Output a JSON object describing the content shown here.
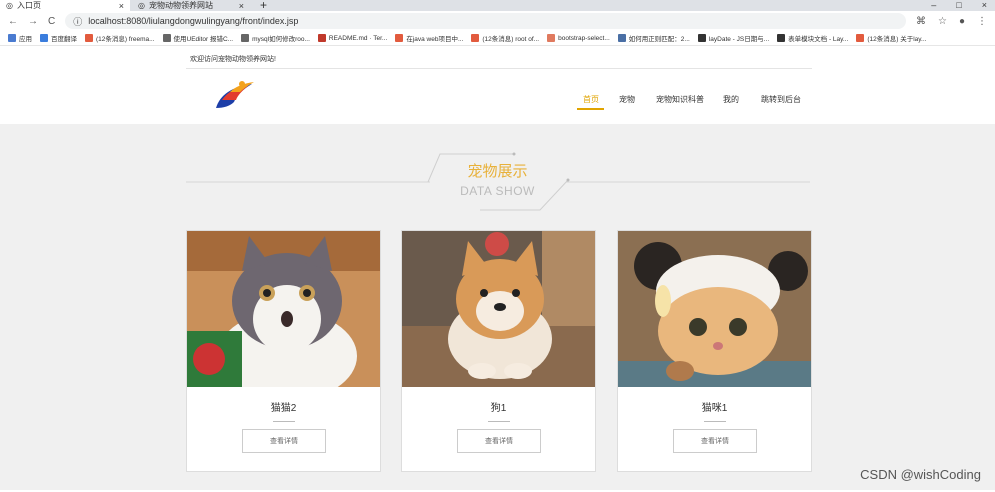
{
  "browser": {
    "tabs": [
      {
        "title": "入口页",
        "close": "×"
      },
      {
        "title": "宠物动物领养网站",
        "close": "×"
      }
    ],
    "new_tab": "+",
    "window_controls": [
      "–",
      "□",
      "×"
    ],
    "url": "localhost:8080/liulangdongwulingyang/front/index.jsp",
    "bookmarks": [
      {
        "label": "应用",
        "color": "#4a7bd0"
      },
      {
        "label": "百度翻译",
        "color": "#3b7ddd"
      },
      {
        "label": "(12条消息) freema...",
        "color": "#e25b3e"
      },
      {
        "label": "使用UEditor 报错C...",
        "color": "#666666"
      },
      {
        "label": "mysql如何修改roo...",
        "color": "#666666"
      },
      {
        "label": "README.md · Ter...",
        "color": "#c0392b"
      },
      {
        "label": "在java web项目中...",
        "color": "#e25b3e"
      },
      {
        "label": "(12条消息) root of...",
        "color": "#e25b3e"
      },
      {
        "label": "bootstrap-select...",
        "color": "#e07a5f"
      },
      {
        "label": "如何用正则匹配：2...",
        "color": "#4a6fa5"
      },
      {
        "label": "layDate - JS日期与...",
        "color": "#333333"
      },
      {
        "label": "表单模块文档 - Lay...",
        "color": "#333333"
      },
      {
        "label": "(12条消息) 关于lay...",
        "color": "#e25b3e"
      }
    ]
  },
  "site": {
    "welcome": "欢迎访问宠物动物领养网站!",
    "nav": [
      "首页",
      "宠物",
      "宠物知识科普",
      "我的",
      "跳转到后台"
    ],
    "active_nav": "首页",
    "section_title": "宠物展示",
    "section_subtitle": "DATA SHOW",
    "cards": [
      {
        "name": "猫猫2",
        "button": "查看详情",
        "image": "cat-image"
      },
      {
        "name": "狗1",
        "button": "查看详情",
        "image": "dog-image"
      },
      {
        "name": "猫咪1",
        "button": "查看详情",
        "image": "cat-image"
      }
    ]
  },
  "watermark": "CSDN @wishCoding",
  "colors": {
    "accent": "#e1a400",
    "title": "#e8b13a",
    "bg_gray": "#f0f0f0"
  }
}
